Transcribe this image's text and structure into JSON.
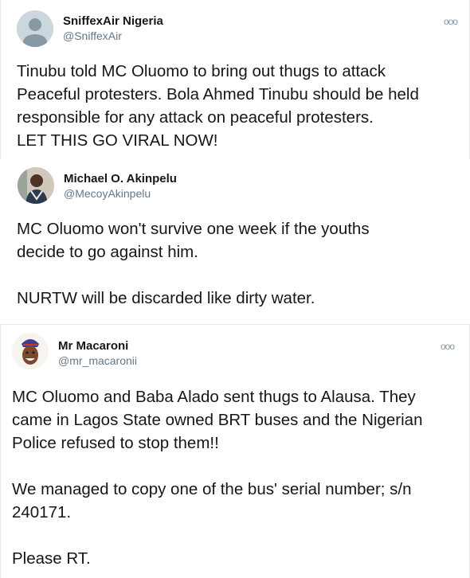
{
  "tweets": [
    {
      "name": "SniffexAir Nigeria",
      "handle": "@SniffexAir",
      "lines": [
        "Tinubu told MC Oluomo to bring out thugs to attack",
        "Peaceful protesters. Bola Ahmed Tinubu should be held",
        "responsible for any attack on peaceful protesters.",
        "LET THIS GO VIRAL NOW!"
      ]
    },
    {
      "name": "Michael O. Akinpelu",
      "handle": "@MecoyAkinpelu",
      "lines": [
        "MC Oluomo won't survive one week if the youths",
        "decide to go against him."
      ],
      "lines2": [
        "NURTW will be discarded like dirty water."
      ]
    },
    {
      "name": "Mr Macaroni",
      "handle": "@mr_macaronii",
      "lines": [
        "MC Oluomo and Baba Alado sent thugs to Alausa. They",
        "came in Lagos State owned BRT buses and the Nigerian",
        "Police refused to stop them!!"
      ],
      "lines2": [
        "We managed to copy one of the bus' serial number; s/n",
        "240171."
      ],
      "lines3": [
        "Please RT."
      ]
    }
  ],
  "more_label": "ooo"
}
